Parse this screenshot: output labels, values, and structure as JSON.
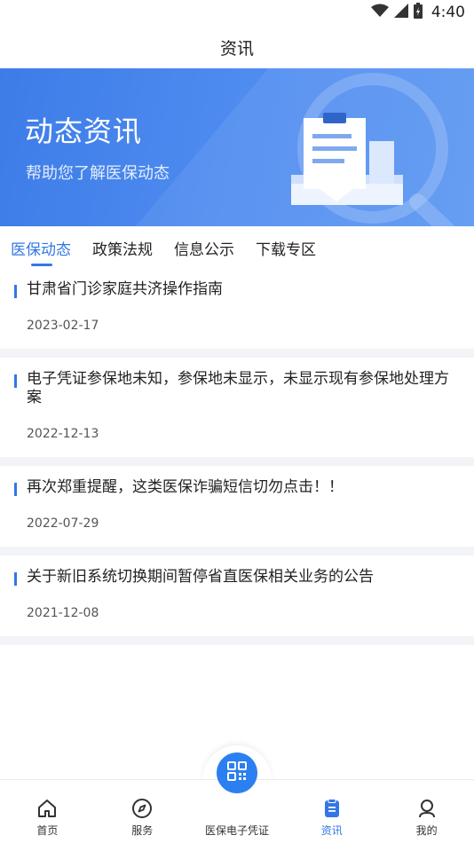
{
  "status_bar": {
    "time": "4:40"
  },
  "header": {
    "title": "资讯"
  },
  "banner": {
    "title": "动态资讯",
    "subtitle": "帮助您了解医保动态",
    "illustration_icon": "news-clipboard-illustration"
  },
  "tabs": [
    {
      "label": "医保动态",
      "active": true
    },
    {
      "label": "政策法规",
      "active": false
    },
    {
      "label": "信息公示",
      "active": false
    },
    {
      "label": "下载专区",
      "active": false
    }
  ],
  "news": [
    {
      "title": "甘肃省门诊家庭共济操作指南",
      "date": "2023-02-17"
    },
    {
      "title": "电子凭证参保地未知，参保地未显示，未显示现有参保地处理方案",
      "date": "2022-12-13"
    },
    {
      "title": "再次郑重提醒，这类医保诈骗短信切勿点击！！",
      "date": "2022-07-29"
    },
    {
      "title": "关于新旧系统切换期间暂停省直医保相关业务的公告",
      "date": "2021-12-08"
    }
  ],
  "bottom_nav": [
    {
      "label": "首页",
      "icon": "home-icon",
      "active": false
    },
    {
      "label": "服务",
      "icon": "compass-icon",
      "active": false
    },
    {
      "label": "医保电子凭证",
      "icon": "qr-code-icon",
      "active": false
    },
    {
      "label": "资讯",
      "icon": "news-icon",
      "active": true
    },
    {
      "label": "我的",
      "icon": "profile-icon",
      "active": false
    }
  ],
  "colors": {
    "accent": "#3377e6",
    "banner": "#4a86ee",
    "divider": "#f3f4f7"
  }
}
